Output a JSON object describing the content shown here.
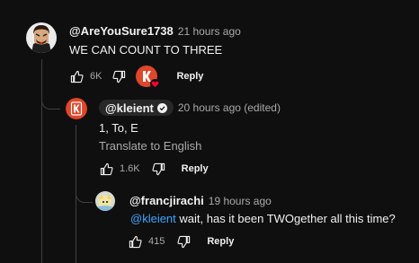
{
  "thread": {
    "top_comment": {
      "author": "@AreYouSure1738",
      "time": "21 hours ago",
      "text": "WE CAN COUNT TO THREE",
      "likes": "6K",
      "reply_label": "Reply",
      "hearted_by_creator": true
    },
    "replies": [
      {
        "author": "@kleient",
        "author_is_creator": true,
        "verified": true,
        "time": "20 hours ago (edited)",
        "text": "1, To, E",
        "translate_label": "Translate to English",
        "likes": "1.6K",
        "reply_label": "Reply"
      },
      {
        "author": "@francjirachi",
        "time": "19 hours ago",
        "mention": "@kleient",
        "text": " wait, has it been TWOgether all this time?",
        "likes": "415",
        "reply_label": "Reply"
      }
    ]
  },
  "colors": {
    "background": "#0f0f0f",
    "text": "#f1f1f1",
    "secondary_text": "#aaaaaa",
    "mention": "#3ea6ff",
    "thread_line": "#3f3f3f",
    "brand_red": "#e0462a",
    "heart": "#ff0033"
  }
}
